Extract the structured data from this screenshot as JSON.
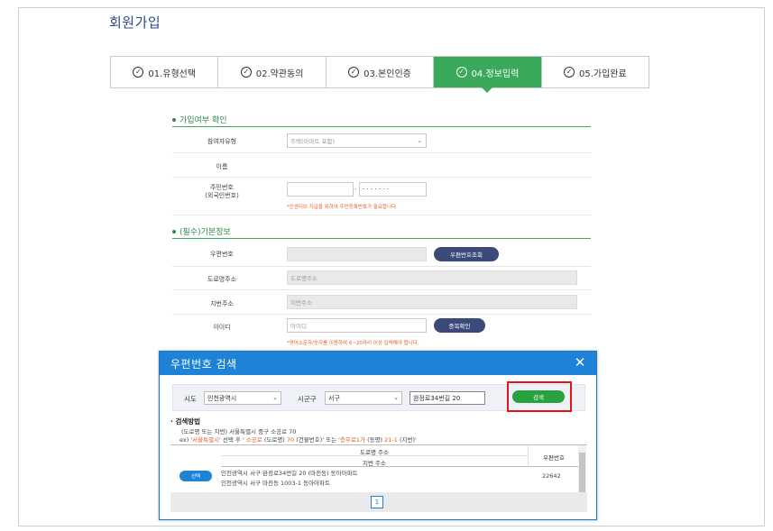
{
  "page": {
    "title": "회원가입"
  },
  "steps": [
    {
      "label": "01.유형선택",
      "active": false
    },
    {
      "label": "02.약관동의",
      "active": false
    },
    {
      "label": "03.본인인증",
      "active": false
    },
    {
      "label": "04.정보입력",
      "active": true
    },
    {
      "label": "05.가입완료",
      "active": false
    }
  ],
  "section1": {
    "title": "가입여부 확인",
    "participant_type": {
      "label": "참여자유형",
      "value": "주택(아파트 포함)"
    },
    "name": {
      "label": "이름"
    },
    "resident": {
      "label": "주민번호\n(외국인번호)",
      "masked": "· · · · · · ·",
      "hint": "*인센티브 지급을 위하여 주민등록번호가 필요합니다."
    }
  },
  "section2": {
    "title": "(필수)기본정보",
    "postcode": {
      "label": "우편번호",
      "button": "우편번호조회"
    },
    "road_address": {
      "label": "도로명주소",
      "placeholder": "도로명주소"
    },
    "jibun_address": {
      "label": "지번주소",
      "placeholder": "지번주소"
    },
    "user_id": {
      "label": "아이디",
      "placeholder": "아이디",
      "button": "중복확인",
      "hint": "*영어소문자/숫자를 이용하여 6~20자리 이상 입력해야 합니다."
    }
  },
  "modal": {
    "title": "우편번호 검색",
    "close": "✕",
    "sido_label": "시도",
    "sido_value": "인천광역시",
    "sigungu_label": "시군구",
    "sigungu_value": "서구",
    "query_value": "완정로34번길 20",
    "search_button": "검색",
    "guide_title": "검색방법",
    "guide_line1": "(도로명 또는 지번) 서울특별시 중구 소공로 70",
    "guide_ex_prefix": "ex) '",
    "guide_ex_city": "서울특별시",
    "guide_ex_mid1": "' 선택 후 ' ",
    "guide_ex_road": "소공로",
    "guide_ex_mid2": " (도로명) ",
    "guide_ex_num": "70",
    "guide_ex_mid3": " (건물번호)' 또는 '",
    "guide_ex_dong": "충무로1가",
    "guide_ex_mid4": " (동명) ",
    "guide_ex_jibun": "21-1",
    "guide_ex_suffix": " (지번)'",
    "table": {
      "head_road": "도로명 주소",
      "head_jibun": "지번 주소",
      "head_postcode": "우편번호",
      "select_button": "선택",
      "row_road": "인천광역시 서구 완정로34번길 20 (마전동) 동아아파트",
      "row_jibun": "인천광역시 서구 마전동 1003-1 동아아파트",
      "row_postcode": "22642"
    },
    "page": "1"
  },
  "colors": {
    "accent_green": "#3aaa5a",
    "modal_blue": "#1e82d6",
    "navy_button": "#3b4a7a",
    "highlight_red": "#e01515"
  }
}
